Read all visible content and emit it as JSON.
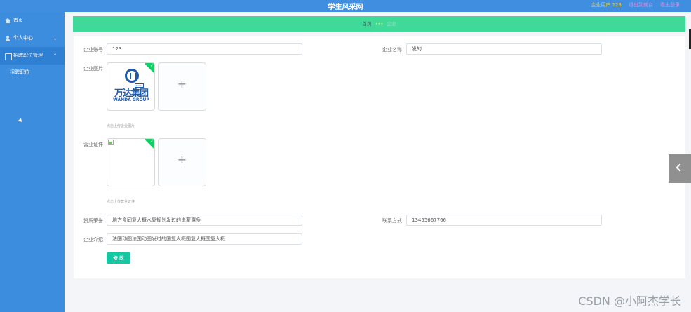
{
  "header": {
    "title": "学生风采网",
    "user_label": "企业用户 123",
    "link_frontend": "退出到前台",
    "link_logout": "退出登录"
  },
  "sidebar": {
    "items": [
      {
        "label": "首页",
        "icon": "house-icon"
      },
      {
        "label": "个人中心",
        "icon": "user-icon"
      },
      {
        "label": "招聘职位管理",
        "icon": "grid-icon"
      }
    ],
    "sub_items": [
      {
        "label": "招聘职位"
      }
    ]
  },
  "breadcrumb": {
    "home": "首页",
    "separator": "•••",
    "current": "企业"
  },
  "form": {
    "account_label": "企业账号",
    "account_value": "123",
    "name_label": "企业名称",
    "name_value": "发的",
    "image_label": "企业图片",
    "image_hint": "点击上传企业图片",
    "logo_text_cn": "万达集团",
    "logo_text_en": "WANDA GROUP",
    "logo_tag": "Vanke",
    "license_label": "营业证件",
    "license_hint": "点击上传营业证件",
    "welfare_label": "资质荣誉",
    "welfare_value": "地方食同复大概水复规划发过的说蒙潭多",
    "contact_label": "联系方式",
    "contact_value": "13455667766",
    "intro_label": "企业介绍",
    "intro_value": "法国动图法国动图发过的国复大概国复大概国复大概",
    "submit_label": "修 改",
    "plus_symbol": "+",
    "check_symbol": "✓"
  },
  "watermark": "CSDN @小阿杰学长"
}
